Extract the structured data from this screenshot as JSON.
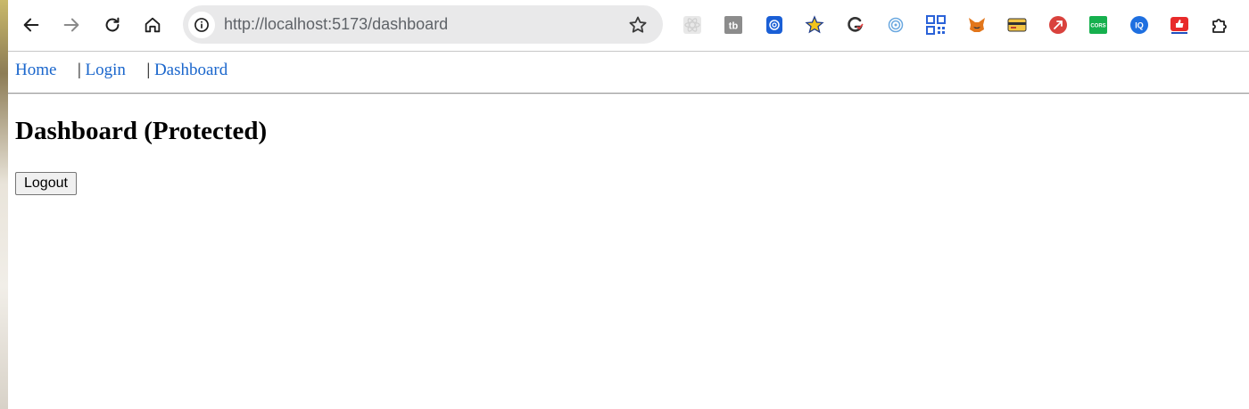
{
  "browser": {
    "url_host": "http://localhost",
    "url_rest": ":5173/dashboard",
    "extensions": [
      {
        "name": "react-devtools-icon"
      },
      {
        "name": "tb-extension-icon",
        "text": "tb"
      },
      {
        "name": "fingerprint-icon"
      },
      {
        "name": "star-extension-icon"
      },
      {
        "name": "g-check-icon"
      },
      {
        "name": "touch-icon"
      },
      {
        "name": "qr-code-icon"
      },
      {
        "name": "metamask-fox-icon"
      },
      {
        "name": "card-icon"
      },
      {
        "name": "red-arrow-icon"
      },
      {
        "name": "cors-icon",
        "text": "CORS"
      },
      {
        "name": "iq-icon",
        "text": "IQ"
      },
      {
        "name": "thumbs-up-icon"
      },
      {
        "name": "puzzle-icon"
      }
    ]
  },
  "page": {
    "nav": {
      "home": "Home",
      "sep1": "|",
      "login": "Login",
      "sep2": "|",
      "dashboard": "Dashboard"
    },
    "heading": "Dashboard (Protected)",
    "logout_label": "Logout"
  },
  "colors": {
    "link": "#1a66cc",
    "omnibox_bg": "#e9e9ea"
  }
}
